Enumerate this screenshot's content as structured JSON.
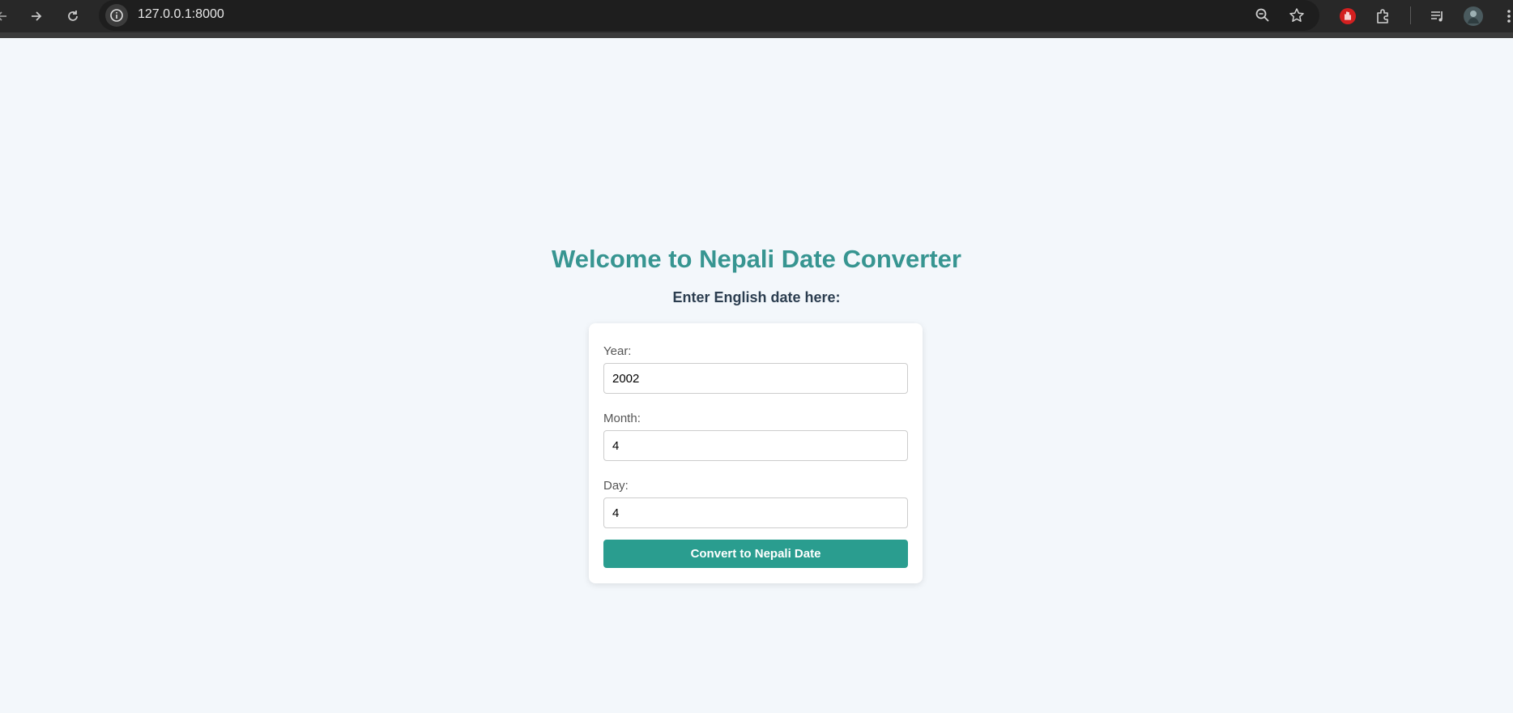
{
  "browser": {
    "url": "127.0.0.1:8000",
    "icons": {
      "back": "back-arrow-icon",
      "forward": "forward-arrow-icon",
      "reload": "reload-icon",
      "site_info": "info-icon",
      "zoom": "zoom-out-icon",
      "bookmark": "star-icon",
      "adblock": "stop-hand-icon",
      "extensions": "puzzle-icon",
      "media": "media-queue-icon",
      "profile": "avatar-icon",
      "menu": "kebab-menu-icon"
    }
  },
  "page": {
    "title": "Welcome to Nepali Date Converter",
    "subtitle": "Enter English date here:"
  },
  "form": {
    "year_label": "Year:",
    "year_value": "2002",
    "month_label": "Month:",
    "month_value": "4",
    "day_label": "Day:",
    "day_value": "4",
    "submit_label": "Convert to Nepali Date"
  },
  "colors": {
    "accent": "#2a9d8f",
    "title": "#379591",
    "background": "#f3f7fb"
  }
}
